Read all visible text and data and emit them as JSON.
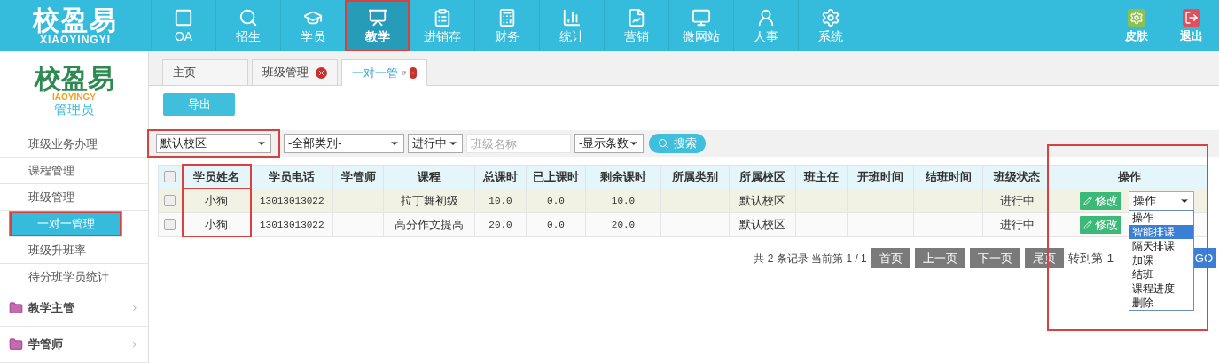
{
  "brand": {
    "name": "校盈易",
    "subtitle": "XIAOYINGYI"
  },
  "nav": [
    {
      "label": "OA",
      "selected": false,
      "highlighted": false
    },
    {
      "label": "招生",
      "selected": false,
      "highlighted": false
    },
    {
      "label": "学员",
      "selected": false,
      "highlighted": false
    },
    {
      "label": "教学",
      "selected": true,
      "highlighted": true
    },
    {
      "label": "进销存",
      "selected": false,
      "highlighted": false
    },
    {
      "label": "财务",
      "selected": false,
      "highlighted": false
    },
    {
      "label": "统计",
      "selected": false,
      "highlighted": false
    },
    {
      "label": "营销",
      "selected": false,
      "highlighted": false
    },
    {
      "label": "微网站",
      "selected": false,
      "highlighted": false
    },
    {
      "label": "人事",
      "selected": false,
      "highlighted": false
    },
    {
      "label": "系统",
      "selected": false,
      "highlighted": false
    }
  ],
  "nav_right": [
    {
      "label": "皮肤",
      "kind": "skin"
    },
    {
      "label": "退出",
      "kind": "logout"
    }
  ],
  "sidebar": {
    "logo": {
      "name": "校盈易",
      "subtitle": "IAOYINGY"
    },
    "role": "管理员",
    "items": [
      {
        "label": "班级业务办理",
        "selected": false,
        "highlighted": false
      },
      {
        "label": "课程管理",
        "selected": false,
        "highlighted": false
      },
      {
        "label": "班级管理",
        "selected": false,
        "highlighted": false
      },
      {
        "label": "一对一管理",
        "selected": true,
        "highlighted": true
      },
      {
        "label": "班级升班率",
        "selected": false,
        "highlighted": false
      },
      {
        "label": "待分班学员统计",
        "selected": false,
        "highlighted": false
      }
    ],
    "groups": [
      {
        "label": "教学主管",
        "expanded": false
      },
      {
        "label": "学管师",
        "expanded": false
      }
    ]
  },
  "tabs": [
    {
      "label": "主页",
      "selected": false,
      "closable": false,
      "refreshable": false
    },
    {
      "label": "班级管理",
      "selected": false,
      "closable": true,
      "refreshable": false
    },
    {
      "label": "一对一管",
      "selected": true,
      "closable": true,
      "refreshable": true
    }
  ],
  "export_button": "导出",
  "filters": {
    "campus": {
      "value": "默认校区",
      "highlighted": true
    },
    "category": "-全部类别-",
    "status": "进行中",
    "class_name": {
      "placeholder": "班级名称"
    },
    "page_size": "-显示条数",
    "search_button": "搜索"
  },
  "table": {
    "all_checked": false,
    "columns": [
      {
        "label": "学员姓名",
        "highlighted": true
      },
      {
        "label": "学员电话",
        "highlighted": false
      },
      {
        "label": "学管师",
        "highlighted": false
      },
      {
        "label": "课程",
        "highlighted": false
      },
      {
        "label": "总课时",
        "highlighted": false
      },
      {
        "label": "已上课时",
        "highlighted": false
      },
      {
        "label": "剩余课时",
        "highlighted": false
      },
      {
        "label": "所属类别",
        "highlighted": false
      },
      {
        "label": "所属校区",
        "highlighted": false
      },
      {
        "label": "班主任",
        "highlighted": false
      },
      {
        "label": "开班时间",
        "highlighted": false
      },
      {
        "label": "结班时间",
        "highlighted": false
      },
      {
        "label": "班级状态",
        "highlighted": false
      },
      {
        "label": "操作",
        "highlighted": true
      }
    ],
    "rows": [
      {
        "checked": false,
        "hovered": true,
        "cells": [
          "小狗",
          "13013013022",
          "",
          "拉丁舞初级",
          "10.0",
          "0.0",
          "10.0",
          "",
          "默认校区",
          "",
          "",
          "",
          "进行中"
        ],
        "edit_button": "修改",
        "action_select": "操作"
      },
      {
        "checked": false,
        "hovered": false,
        "cells": [
          "小狗",
          "13013013022",
          "",
          "高分作文提高",
          "20.0",
          "0.0",
          "20.0",
          "",
          "默认校区",
          "",
          "",
          "",
          "进行中"
        ],
        "edit_button": "修改"
      }
    ],
    "action_menu": [
      {
        "label": "操作",
        "selected": false
      },
      {
        "label": "智能排课",
        "selected": true
      },
      {
        "label": "隔天排课",
        "selected": false
      },
      {
        "label": "加课",
        "selected": false
      },
      {
        "label": "结班",
        "selected": false
      },
      {
        "label": "课程进度",
        "selected": false
      },
      {
        "label": "删除",
        "selected": false
      }
    ]
  },
  "pagination": {
    "summary": "共 2 条记录 当前第 1 / 1",
    "buttons": [
      "首页",
      "上一页",
      "下一页",
      "尾页"
    ],
    "goto_label": "转到第",
    "goto_value": "1",
    "go_button": "GO"
  }
}
